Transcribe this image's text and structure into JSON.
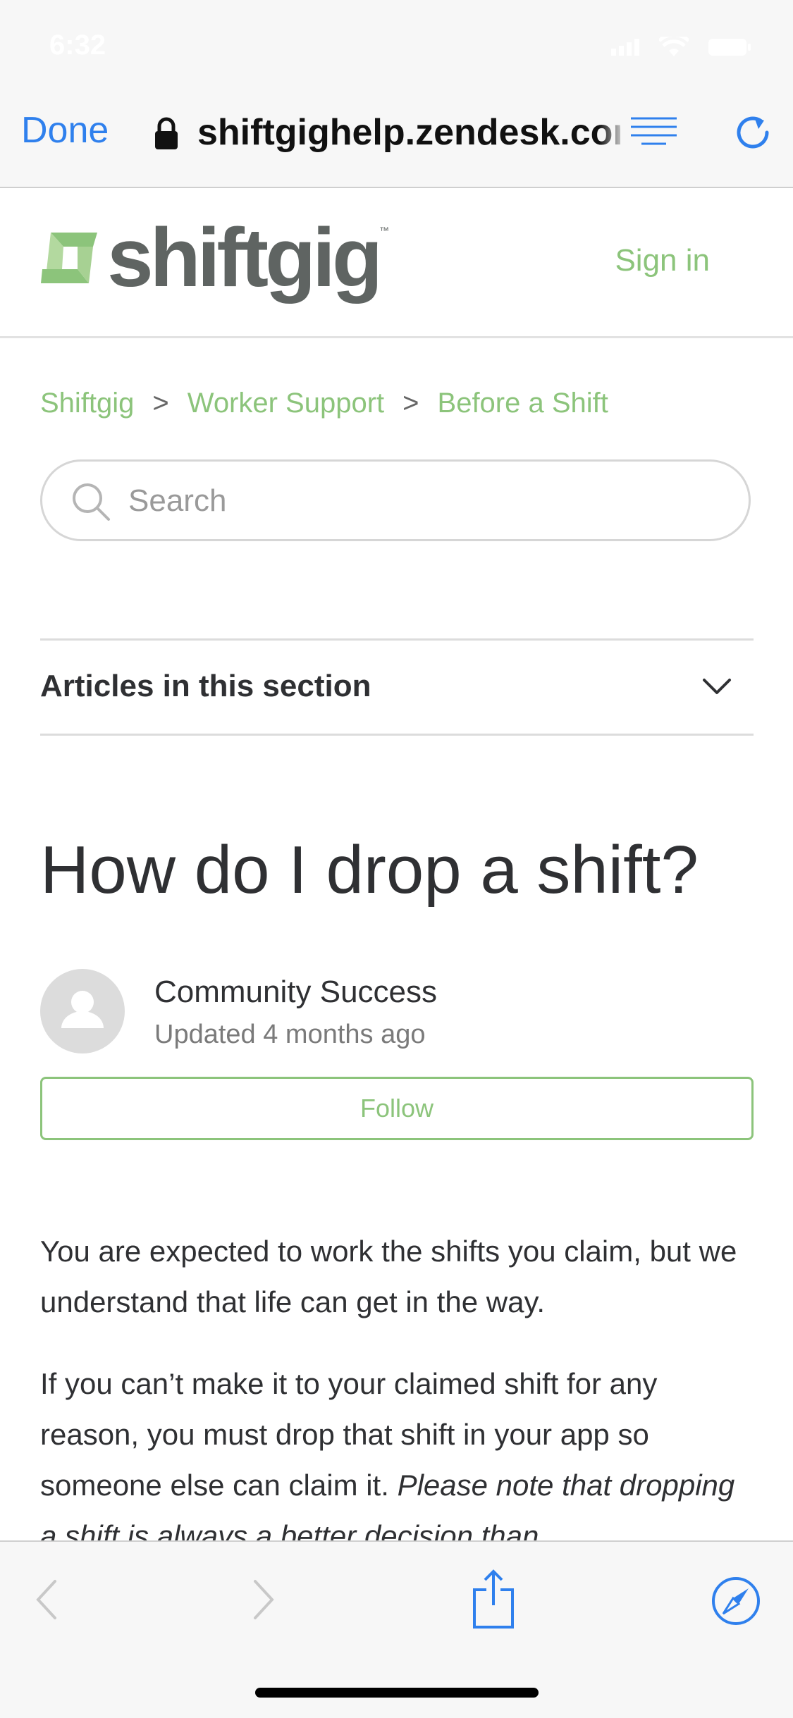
{
  "status_bar": {
    "time": "6:32"
  },
  "browser": {
    "done_label": "Done",
    "url": "shiftgighelp.zendesk.com"
  },
  "site": {
    "logo_text": "shiftgig",
    "logo_tm": "™",
    "sign_in": "Sign in"
  },
  "breadcrumbs": [
    {
      "label": "Shiftgig"
    },
    {
      "label": "Worker Support"
    },
    {
      "label": "Before a Shift"
    }
  ],
  "breadcrumb_separator": ">",
  "search": {
    "placeholder": "Search"
  },
  "section": {
    "label": "Articles in this section"
  },
  "article": {
    "title": "How do I drop a shift?",
    "author": "Community Success",
    "updated": "Updated 4 months ago",
    "follow_label": "Follow",
    "paragraph1": "You are expected to work the shifts you claim, but we understand that life can get in the way.",
    "paragraph2_plain": "If you can’t make it to your claimed shift for any reason, you must drop that shift in your app so someone else can claim it. ",
    "paragraph2_italic": "Please note that dropping a shift is always a better decision than"
  },
  "colors": {
    "brand_green": "#8cc47b",
    "ios_blue": "#2f80ed",
    "text": "#2f3033"
  }
}
